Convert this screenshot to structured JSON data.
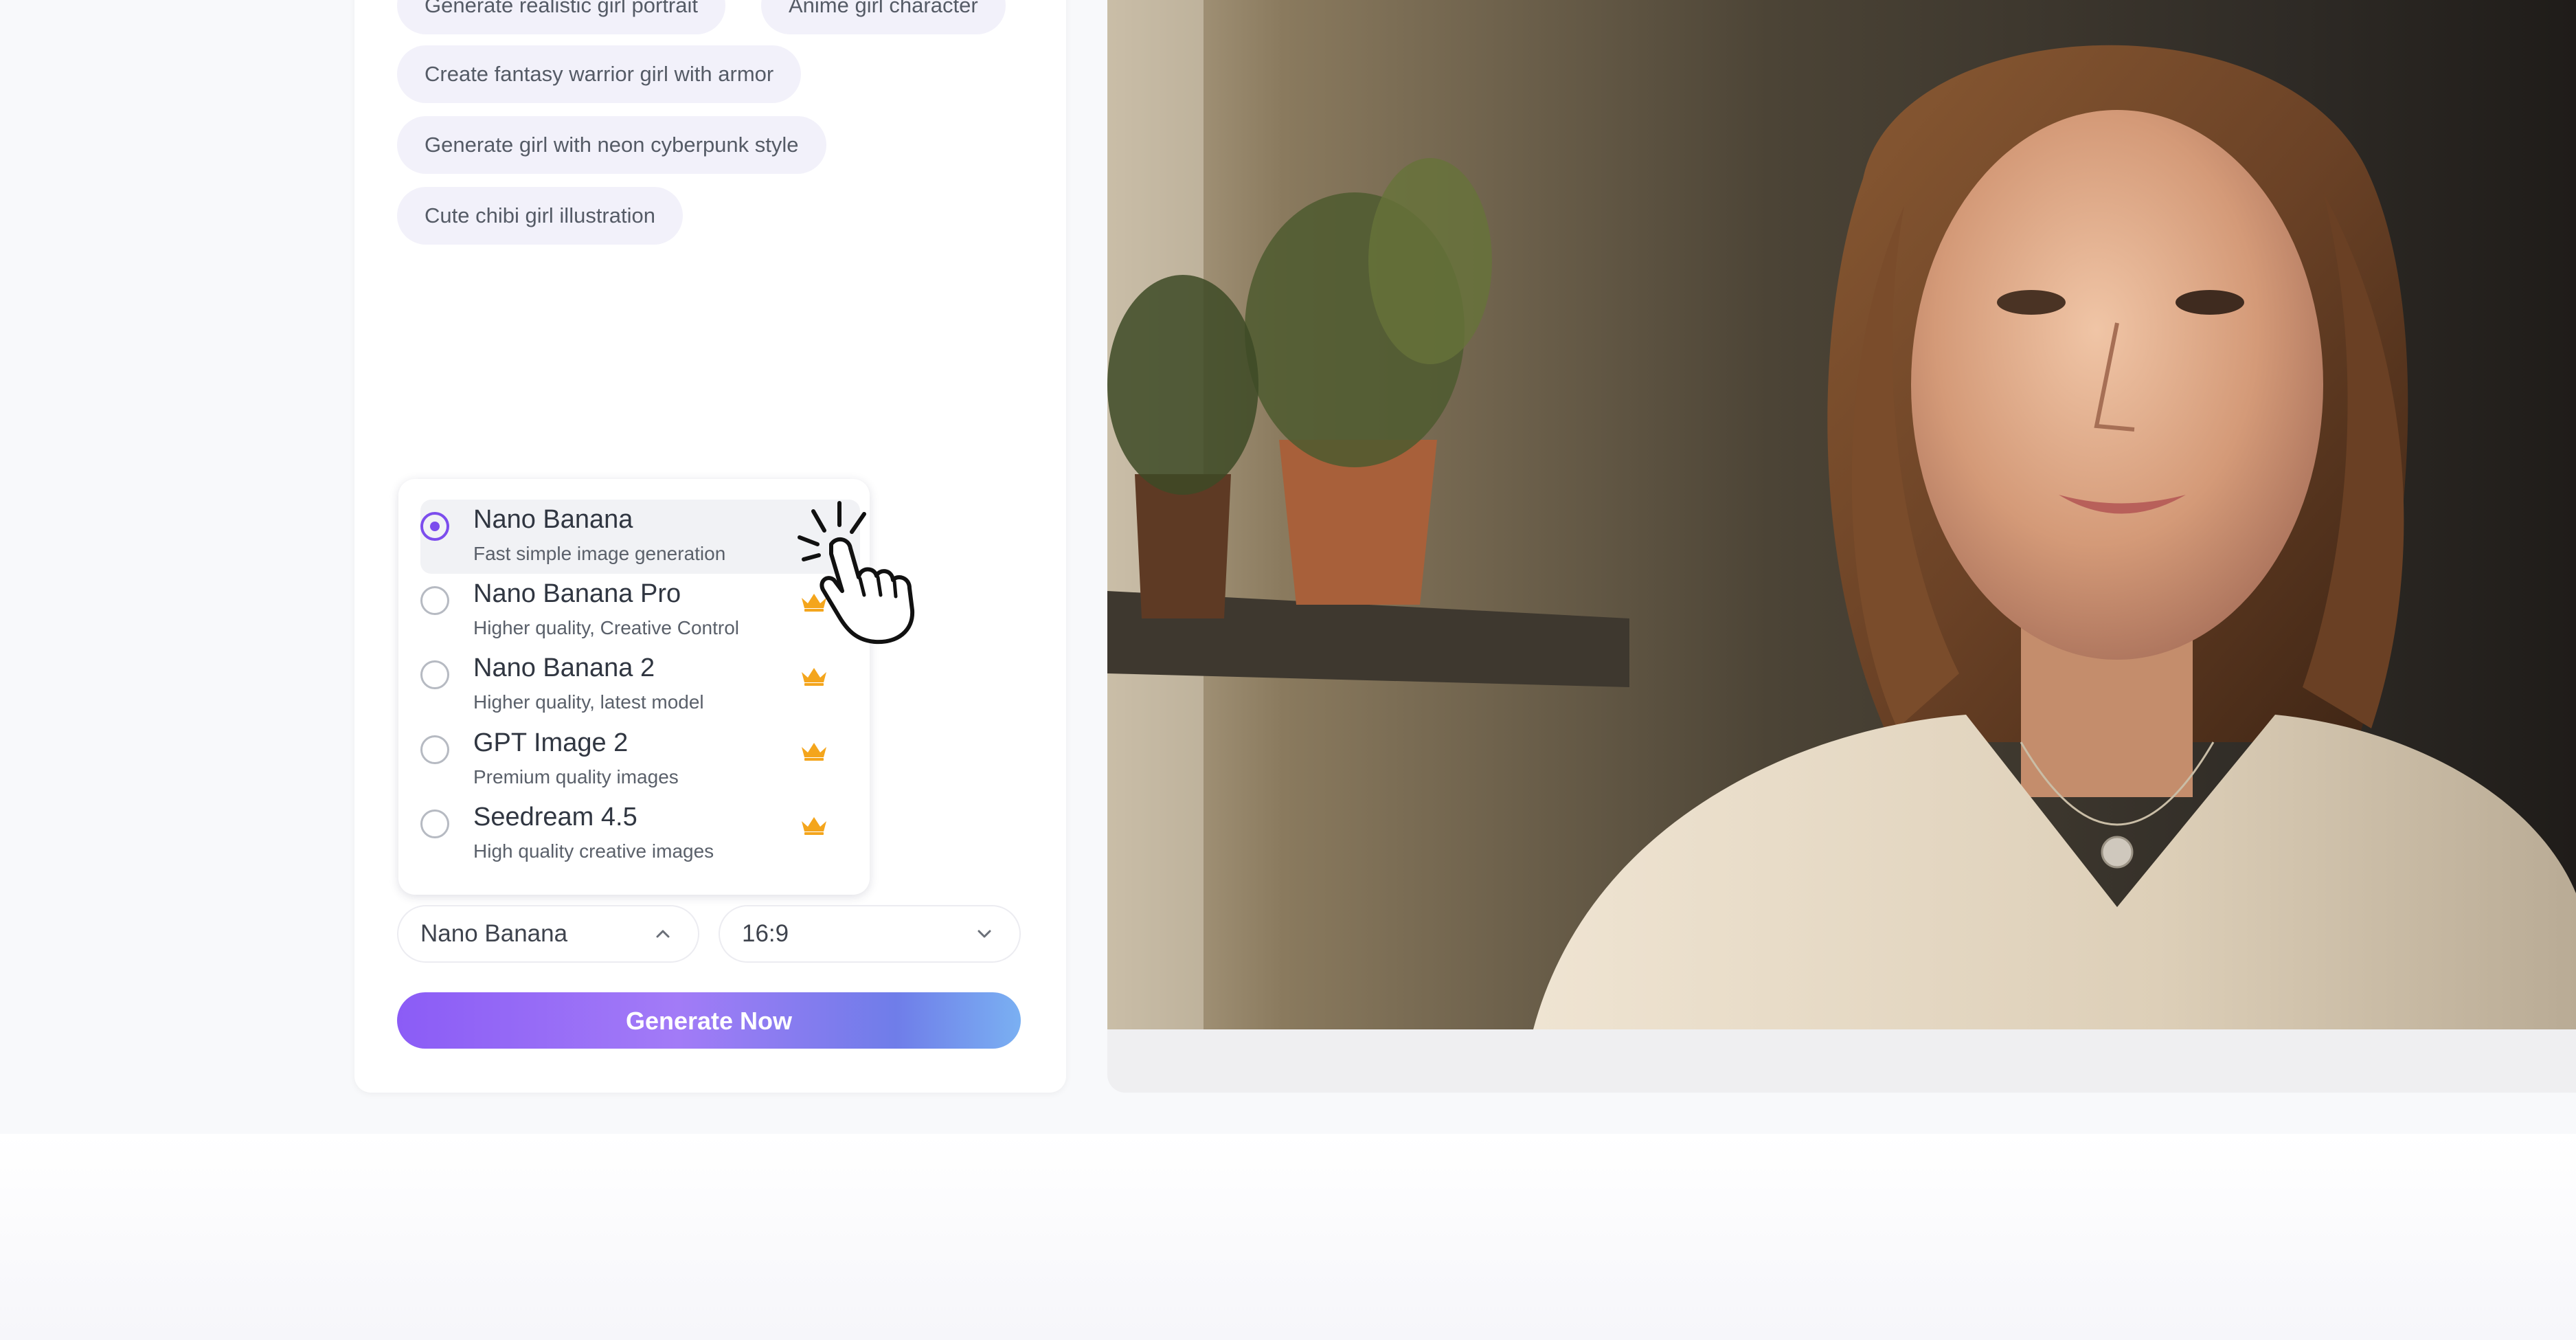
{
  "prompt_suggestions": [
    "Generate realistic girl portrait",
    "Anime girl character",
    "Create fantasy warrior girl with armor",
    "Generate girl with neon cyberpunk style",
    "Cute chibi girl illustration"
  ],
  "model_menu": {
    "options": [
      {
        "name": "Nano Banana",
        "description": "Fast simple image generation",
        "premium": false,
        "selected": true
      },
      {
        "name": "Nano Banana Pro",
        "description": "Higher quality, Creative Control",
        "premium": true,
        "selected": false
      },
      {
        "name": "Nano Banana 2",
        "description": "Higher quality, latest model",
        "premium": true,
        "selected": false
      },
      {
        "name": "GPT Image 2",
        "description": "Premium quality images",
        "premium": true,
        "selected": false
      },
      {
        "name": "Seedream 4.5",
        "description": "High quality creative images",
        "premium": true,
        "selected": false
      }
    ]
  },
  "controls": {
    "model_select_value": "Nano Banana",
    "model_select_open": true,
    "aspect_select_value": "16:9",
    "generate_label": "Generate Now"
  },
  "icons": {
    "radio": "radio-icon",
    "premium": "crown-icon",
    "chevron_up": "chevron-up-icon",
    "chevron_down": "chevron-down-icon",
    "cursor": "hand-pointer-icon"
  },
  "colors": {
    "accent": "#7c4ded",
    "crown": "#f4a51c",
    "chip_bg": "#f2f1fa",
    "button_gradient_start": "#8b5cf6",
    "button_gradient_end": "#7ab0f2"
  }
}
